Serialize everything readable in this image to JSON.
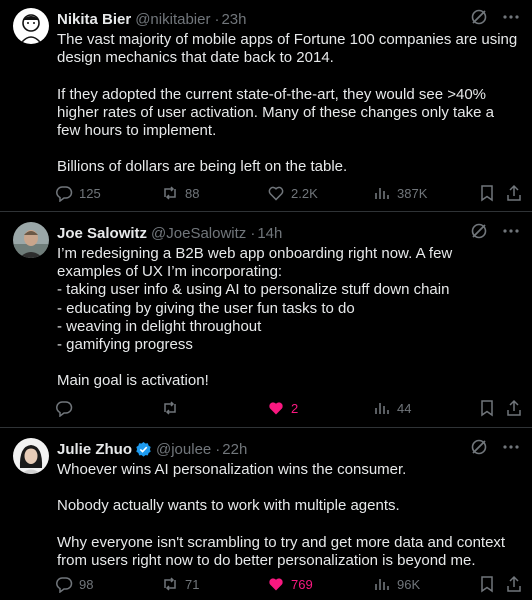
{
  "tweets": [
    {
      "name": "Nikita Bier",
      "handle": "@nikitabier",
      "time": "23h",
      "verified": false,
      "text": "The vast majority of mobile apps of Fortune 100 companies are using design mechanics that date back to 2014.\n\nIf they adopted the current state-of-the-art, they would see >40% higher rates of user activation. Many of these changes only take a few hours to implement.\n\nBillions of dollars are being left on the table.",
      "replies": "125",
      "reposts": "88",
      "likes": "2.2K",
      "views": "387K",
      "liked": false
    },
    {
      "name": "Joe Salowitz",
      "handle": "@JoeSalowitz",
      "time": "14h",
      "verified": false,
      "text": "I’m redesigning a B2B web app onboarding right now. A few examples of UX I’m incorporating:\n- taking user info & using AI to personalize stuff down chain\n- educating by giving the user fun tasks to do\n- weaving in delight throughout\n- gamifying progress\n\nMain goal is activation!",
      "replies": "",
      "reposts": "",
      "likes": "2",
      "views": "44",
      "liked": true
    },
    {
      "name": "Julie Zhuo",
      "handle": "@joulee",
      "time": "22h",
      "verified": true,
      "text": "Whoever wins AI personalization wins the consumer.\n\nNobody actually wants to work with multiple agents.\n\nWhy everyone isn't scrambling to try and get more data and context from users right now to do better personalization is beyond me.",
      "replies": "98",
      "reposts": "71",
      "likes": "769",
      "views": "96K",
      "liked": true
    }
  ],
  "colors": {
    "bg": "#000000",
    "text": "#e7e9ea",
    "muted": "#71767b",
    "like": "#f91880",
    "verified": "#1d9bf0",
    "divider": "#2f3336"
  }
}
